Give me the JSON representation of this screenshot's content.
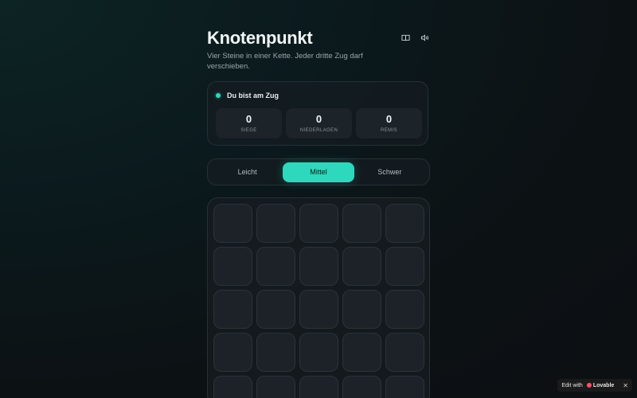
{
  "header": {
    "title": "Knotenpunkt",
    "subtitle": "Vier Steine in einer Kette. Jeder dritte Zug darf verschieben.",
    "icons": [
      "book-icon",
      "speaker-icon"
    ]
  },
  "status": {
    "turn_text": "Du bist am Zug",
    "stats": [
      {
        "value": "0",
        "label": "SIEGE"
      },
      {
        "value": "0",
        "label": "NIEDERLAGEN"
      },
      {
        "value": "0",
        "label": "REMIS"
      }
    ]
  },
  "difficulty": {
    "options": [
      "Leicht",
      "Mittel",
      "Schwer"
    ],
    "selected": "Mittel"
  },
  "board": {
    "columns": 5,
    "visible_rows": 5
  },
  "badge": {
    "prefix": "Edit with",
    "brand": "Lovable",
    "close": "✕"
  },
  "colors": {
    "accent": "#2ed8bc",
    "background": "#0c1114",
    "card": "#161c21",
    "cell": "#1c2228"
  }
}
